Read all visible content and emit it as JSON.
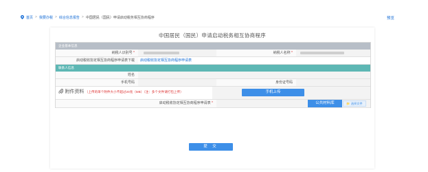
{
  "breadcrumb": {
    "home": "首页",
    "sep": ">",
    "office": "我要办税",
    "reports": "综合信息报告",
    "current": "中国居民（国民）申请启动税务相互协商程序"
  },
  "preview_label": "预览",
  "form": {
    "title": "中国居民（国民）申请启动税务相互协商程序",
    "section_company": "企业基本信息",
    "taxpayer_id_label": "纳税人识别号",
    "taxpayer_name_label": "纳税人名称",
    "required_mark": "*",
    "template_label": "启动税收协定相互协商程序申请表下载",
    "template_link": "启动税收协定相互协商程序申请表",
    "section_contact": "联系人信息",
    "name_label": "姓名",
    "phone_label": "手机号码",
    "id_label": "身份证号码",
    "attachments_title": "附件资料",
    "attachments_note": "（上传的单个附件大小不超过20兆（MB）（注：多个文件请打包上传）",
    "mobile_upload": "手机上传",
    "file_row_label": "启动税收协定相互协商程序申请表",
    "public_library": "公共材料库",
    "choose_file": "选择文件",
    "submit": "提 交"
  },
  "colors": {
    "accent": "#3d8fe8",
    "link": "#1a6fd6",
    "section_grey": "#b7bec7",
    "section_teal": "#5db7b4",
    "required": "#dd3333"
  },
  "icons": {
    "breadcrumb": "location-pin-icon",
    "attachments": "paperclip-icon",
    "choose_file": "folder-icon"
  }
}
